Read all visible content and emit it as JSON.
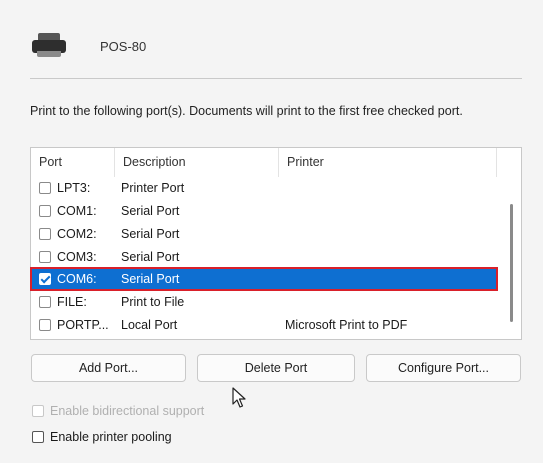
{
  "printer": {
    "name": "POS-80",
    "icon": "printer-icon"
  },
  "instructions": "Print to the following port(s). Documents will print to the first free checked port.",
  "port_list": {
    "columns": [
      "Port",
      "Description",
      "Printer"
    ],
    "rows": [
      {
        "port": "LPT3:",
        "description": "Printer Port",
        "printer": "",
        "checked": false,
        "selected": false
      },
      {
        "port": "COM1:",
        "description": "Serial Port",
        "printer": "",
        "checked": false,
        "selected": false
      },
      {
        "port": "COM2:",
        "description": "Serial Port",
        "printer": "",
        "checked": false,
        "selected": false
      },
      {
        "port": "COM3:",
        "description": "Serial Port",
        "printer": "",
        "checked": false,
        "selected": false
      },
      {
        "port": "COM6:",
        "description": "Serial Port",
        "printer": "",
        "checked": true,
        "selected": true
      },
      {
        "port": "FILE:",
        "description": "Print to File",
        "printer": "",
        "checked": false,
        "selected": false
      },
      {
        "port": "PORTP...",
        "description": "Local Port",
        "printer": "Microsoft Print to PDF",
        "checked": false,
        "selected": false
      }
    ]
  },
  "buttons": {
    "add": "Add Port...",
    "delete": "Delete Port",
    "configure": "Configure Port..."
  },
  "options": {
    "bidirectional": {
      "label": "Enable bidirectional support",
      "checked": false,
      "disabled": true
    },
    "pooling": {
      "label": "Enable printer pooling",
      "checked": false,
      "disabled": false
    }
  },
  "colors": {
    "selection": "#0e6fd1",
    "highlight_border": "#d9202a"
  }
}
